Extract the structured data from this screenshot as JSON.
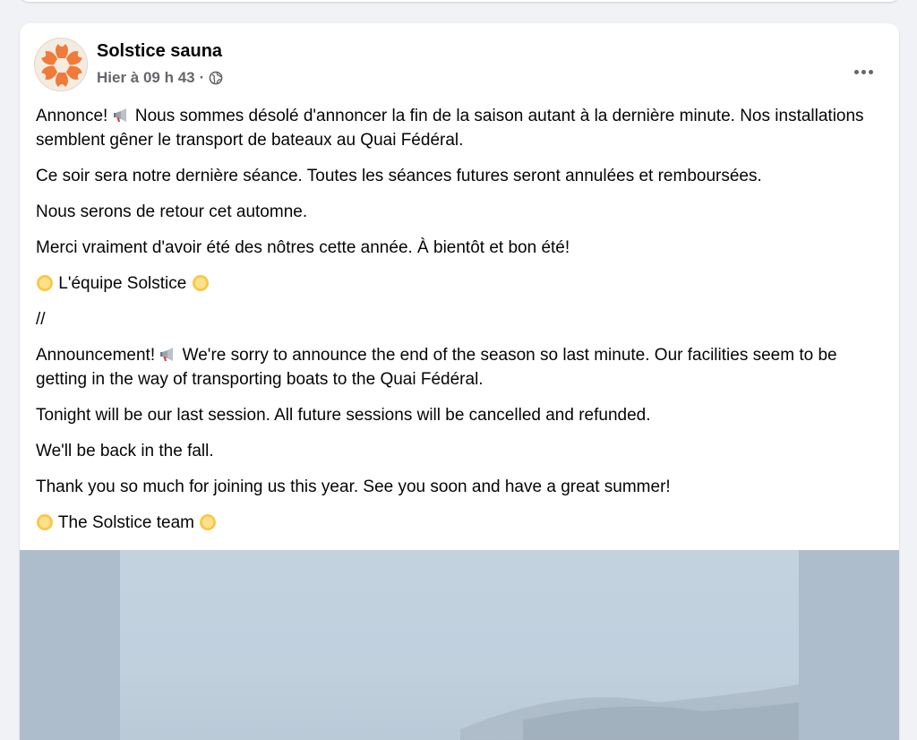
{
  "post": {
    "page_name": "Solstice sauna",
    "timestamp": "Hier à 09 h 43",
    "separator": "·",
    "paragraphs_fr": {
      "p1_a": "Annonce! ",
      "p1_b": " Nous sommes désolé d'annoncer la fin de la saison autant à la dernière minute. Nos installations semblent gêner le transport de bateaux au Quai Fédéral.",
      "p2": "Ce soir sera notre dernière séance. Toutes les séances futures seront annulées et remboursées.",
      "p3": "Nous serons de retour cet automne.",
      "p4": "Merci vraiment d'avoir été des nôtres cette année. À bientôt et bon été!",
      "signature": " L'équipe Solstice "
    },
    "divider": "//",
    "paragraphs_en": {
      "p1_a": "Announcement! ",
      "p1_b": " We're sorry to announce the end of the season so last minute. Our facilities seem to be getting in the way of transporting boats to the Quai Fédéral.",
      "p2": "Tonight will be our last session. All future sessions will be cancelled and refunded.",
      "p3": "We'll be back in the fall.",
      "p4": "Thank you so much for joining us this year. See you soon and have a great summer!",
      "signature": " The Solstice team "
    }
  },
  "icons": {
    "avatar": "solstice-sun-logo",
    "privacy": "globe-icon",
    "menu": "more-options-icon",
    "emoji_announce": "megaphone-icon",
    "emoji_sun": "sun-icon"
  },
  "colors": {
    "page_bg": "#f0f2f5",
    "card_bg": "#ffffff",
    "secondary_text": "#65676b",
    "logo_orange": "#f07a3a"
  }
}
